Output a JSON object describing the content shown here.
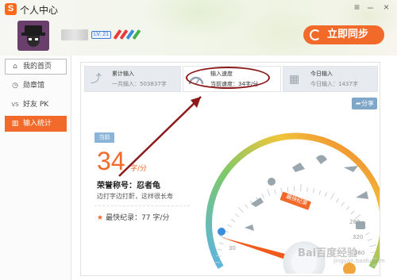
{
  "window": {
    "logo_glyph": "S",
    "title": "个人中心",
    "menu_glyph": "≡",
    "minimize_glyph": "–",
    "close_glyph": "×"
  },
  "profile": {
    "username": "",
    "level": "LV. 21",
    "sync_label": "立即同步"
  },
  "sidebar": {
    "items": [
      {
        "label": "我的首页",
        "icon": "home-icon",
        "glyph": "⌂",
        "state": "selected"
      },
      {
        "label": "勋章馆",
        "icon": "medal-icon",
        "glyph": "◷",
        "state": "normal"
      },
      {
        "label": "好友 PK",
        "icon": "vs-icon",
        "glyph": "VS",
        "state": "normal"
      },
      {
        "label": "输入统计",
        "icon": "stats-icon",
        "glyph": "▥",
        "state": "active"
      }
    ]
  },
  "stats": {
    "total": {
      "title": "累计输入",
      "value": "一共输入：503837字",
      "icon": "chart-icon",
      "glyph": "⤴"
    },
    "speed": {
      "title": "输入速度",
      "value": "当前速度：34字/分",
      "icon": "speedometer-icon"
    },
    "today": {
      "title": "今日输入",
      "value": "今日输入：1437字",
      "icon": "calendar-icon",
      "glyph": "▦"
    }
  },
  "share": {
    "label": "分享",
    "glyph": "➦"
  },
  "current": {
    "tag": "当前",
    "speed": "34",
    "unit": "字/分",
    "rank_title": "荣誉称号：忍者龟",
    "rank_desc": "边打字边打鼾，这样很长寿",
    "record_label": "最快纪录：77 字/分",
    "star_glyph": "★"
  },
  "gauge": {
    "value": 34,
    "record": 77,
    "record_tag": "最快纪录",
    "tick_labels": [
      "30",
      "280",
      "320",
      "360"
    ],
    "colors": {
      "low": "#5bb3e6",
      "mid": "#7cc86a",
      "high": "#f0c53a",
      "top": "#f26a2a",
      "needle": "#f05a1a"
    }
  },
  "watermark": {
    "text": "Bai百度经验",
    "sub": "jingyan.baidu.com"
  }
}
